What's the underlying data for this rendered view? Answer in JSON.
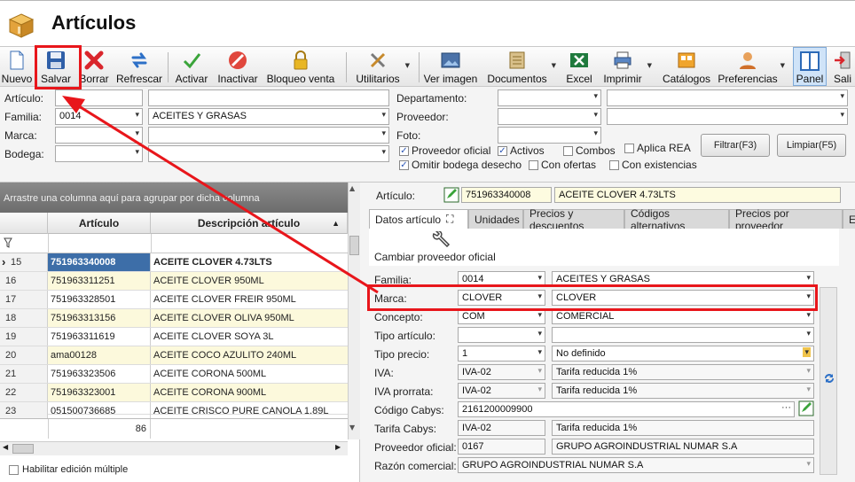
{
  "window": {
    "title": "Artículos"
  },
  "toolbar": {
    "nuevo": "Nuevo",
    "salvar": "Salvar",
    "borrar": "Borrar",
    "refrescar": "Refrescar",
    "activar": "Activar",
    "inactivar": "Inactivar",
    "bloqueo_venta": "Bloqueo venta",
    "utilitarios": "Utilitarios",
    "ver_imagen": "Ver imagen",
    "documentos": "Documentos",
    "excel": "Excel",
    "imprimir": "Imprimir",
    "catalogos": "Catálogos",
    "preferencias": "Preferencias",
    "panel": "Panel",
    "salir": "Sali"
  },
  "filters": {
    "articulo_label": "Artículo:",
    "articulo_value": "",
    "articulo_desc": "",
    "familia_label": "Familia:",
    "familia_code": "0014",
    "familia_name": "ACEITES Y GRASAS",
    "marca_label": "Marca:",
    "marca_code": "",
    "marca_name": "",
    "bodega_label": "Bodega:",
    "bodega_code": "",
    "bodega_name": "",
    "departamento_label": "Departamento:",
    "proveedor_label": "Proveedor:",
    "foto_label": "Foto:",
    "proveedor_oficial": "Proveedor oficial",
    "activos": "Activos",
    "combos": "Combos",
    "aplica_rea": "Aplica REA",
    "omitir_bodega": "Omitir bodega desecho",
    "con_ofertas": "Con ofertas",
    "con_existencias": "Con existencias",
    "filtrar": "Filtrar(F3)",
    "limpiar": "Limpiar(F5)"
  },
  "grid": {
    "group_hint": "Arrastre una columna aquí para agrupar por dicha columna",
    "col_articulo": "Artículo",
    "col_descripcion": "Descripción artículo",
    "rows": [
      {
        "n": "15",
        "code": "751963340008",
        "desc": "ACEITE CLOVER 4.73LTS"
      },
      {
        "n": "16",
        "code": "751963311251",
        "desc": "ACEITE CLOVER 950ML"
      },
      {
        "n": "17",
        "code": "751963328501",
        "desc": "ACEITE CLOVER FREIR 950ML"
      },
      {
        "n": "18",
        "code": "751963313156",
        "desc": "ACEITE CLOVER OLIVA 950ML"
      },
      {
        "n": "19",
        "code": "751963311619",
        "desc": "ACEITE CLOVER SOYA 3L"
      },
      {
        "n": "20",
        "code": "ama00128",
        "desc": "ACEITE COCO AZULITO 240ML"
      },
      {
        "n": "21",
        "code": "751963323506",
        "desc": "ACEITE CORONA 500ML"
      },
      {
        "n": "22",
        "code": "751963323001",
        "desc": "ACEITE CORONA 900ML"
      },
      {
        "n": "23",
        "code": "051500736685",
        "desc": "ACEITE CRISCO PURE CANOLA 1.89L"
      }
    ],
    "total": "86",
    "multi_edit": "Habilitar edición múltiple"
  },
  "detail": {
    "articulo_label": "Artículo:",
    "articulo_code": "751963340008",
    "articulo_desc": "ACEITE CLOVER 4.73LTS",
    "tabs": [
      "Datos artículo",
      "Unidades",
      "Precios y descuentos",
      "Códigos alternativos",
      "Precios por proveedor",
      "Ex"
    ],
    "cambiar_proveedor": "Cambiar proveedor oficial",
    "familia_label": "Familia:",
    "familia_code": "0014",
    "familia_name": "ACEITES Y GRASAS",
    "marca_label": "Marca:",
    "marca_code": "CLOVER",
    "marca_name": "CLOVER",
    "concepto_label": "Concepto:",
    "concepto_code": "COM",
    "concepto_name": "COMERCIAL",
    "tipo_articulo_label": "Tipo artículo:",
    "tipo_precio_label": "Tipo precio:",
    "tipo_precio_code": "1",
    "tipo_precio_name": "No definido",
    "iva_label": "IVA:",
    "iva_code": "IVA-02",
    "iva_name": "Tarifa reducida 1%",
    "iva_prorrata_label": "IVA prorrata:",
    "iva_prorrata_code": "IVA-02",
    "iva_prorrata_name": "Tarifa reducida 1%",
    "cabys_label": "Código Cabys:",
    "cabys_value": "2161200009900",
    "tarifa_cabys_label": "Tarifa Cabys:",
    "tarifa_cabys_code": "IVA-02",
    "tarifa_cabys_name": "Tarifa reducida 1%",
    "proveedor_oficial_label": "Proveedor oficial:",
    "proveedor_code": "0167",
    "proveedor_name": "GRUPO AGROINDUSTRIAL NUMAR S.A",
    "razon_label": "Razón comercial:",
    "razon_value": "GRUPO AGROINDUSTRIAL NUMAR S.A"
  },
  "colors": {
    "accent": "#3d6ea8",
    "highlight": "#e8161b",
    "row_alt": "#fcf9dc"
  }
}
